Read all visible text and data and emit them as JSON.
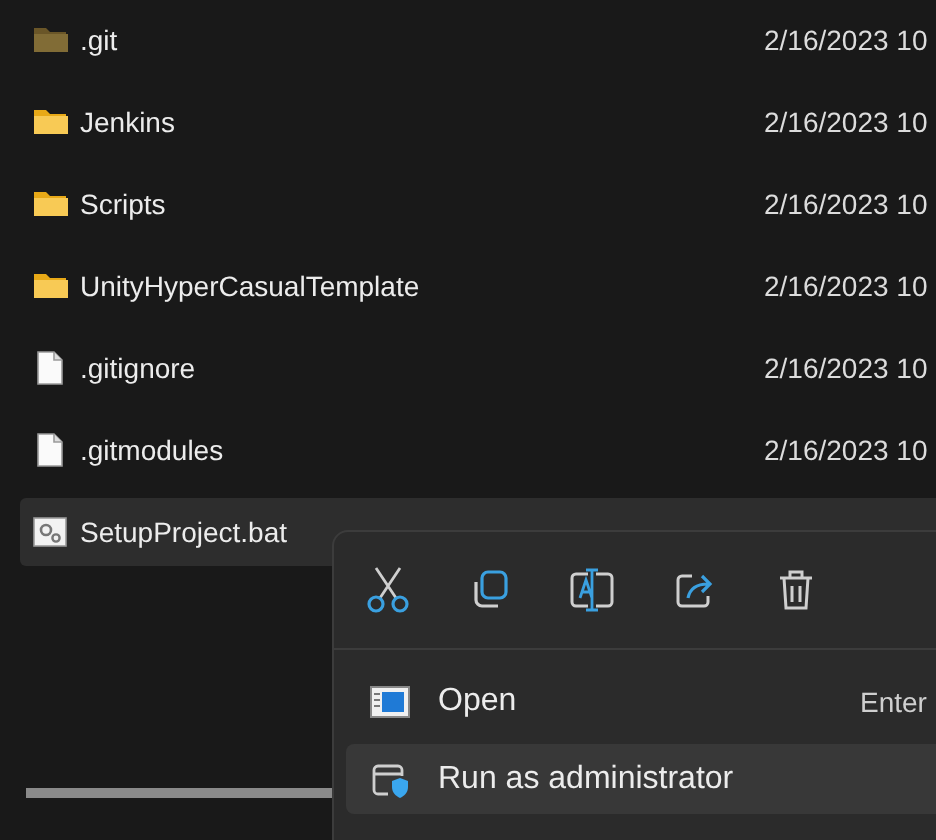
{
  "files": [
    {
      "name": ".git",
      "kind": "folder",
      "hidden": true,
      "modified": "2/16/2023 10",
      "selected": false
    },
    {
      "name": "Jenkins",
      "kind": "folder",
      "hidden": false,
      "modified": "2/16/2023 10",
      "selected": false
    },
    {
      "name": "Scripts",
      "kind": "folder",
      "hidden": false,
      "modified": "2/16/2023 10",
      "selected": false
    },
    {
      "name": "UnityHyperCasualTemplate",
      "kind": "folder",
      "hidden": false,
      "modified": "2/16/2023 10",
      "selected": false
    },
    {
      "name": ".gitignore",
      "kind": "file",
      "modified": "2/16/2023 10",
      "selected": false
    },
    {
      "name": ".gitmodules",
      "kind": "file",
      "modified": "2/16/2023 10",
      "selected": false
    },
    {
      "name": "SetupProject.bat",
      "kind": "batch",
      "selected": true
    }
  ],
  "context_menu": {
    "toolbar": [
      {
        "kind": "cut"
      },
      {
        "kind": "copy"
      },
      {
        "kind": "rename"
      },
      {
        "kind": "share"
      },
      {
        "kind": "delete"
      }
    ],
    "items": [
      {
        "kind": "open",
        "label": "Open",
        "shortcut": "Enter",
        "selected": false
      },
      {
        "kind": "admin",
        "label": "Run as administrator",
        "selected": true
      }
    ]
  }
}
